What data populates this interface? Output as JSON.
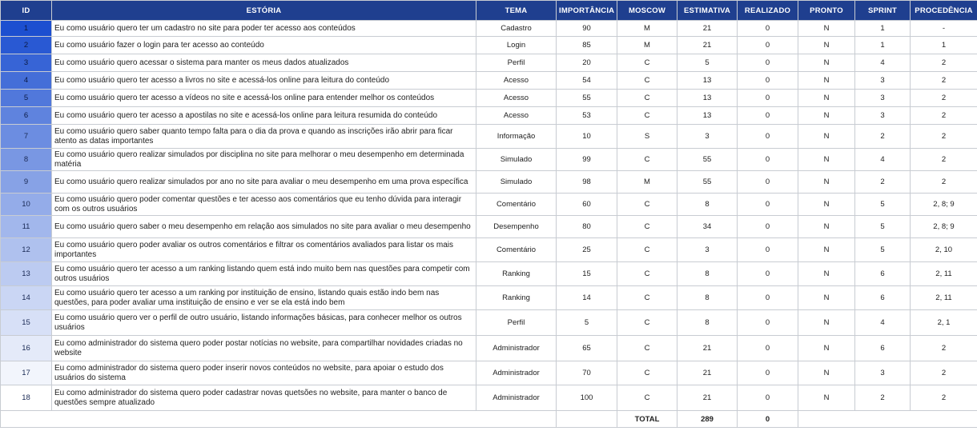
{
  "headers": [
    "ID",
    "ESTÓRIA",
    "TEMA",
    "IMPORTÂNCIA",
    "MOSCOW",
    "ESTIMATIVA",
    "REALIZADO",
    "PRONTO",
    "SPRINT",
    "PROCEDÊNCIA"
  ],
  "rows": [
    {
      "id": "1",
      "story": "Eu como usuário quero ter um cadastro no site para poder ter acesso aos conteúdos",
      "tema": "Cadastro",
      "imp": "90",
      "moscow": "M",
      "est": "21",
      "real": "0",
      "pronto": "N",
      "sprint": "1",
      "proc": "-"
    },
    {
      "id": "2",
      "story": "Eu como usuário fazer o login para ter acesso ao conteúdo",
      "tema": "Login",
      "imp": "85",
      "moscow": "M",
      "est": "21",
      "real": "0",
      "pronto": "N",
      "sprint": "1",
      "proc": "1"
    },
    {
      "id": "3",
      "story": "Eu como usuário quero acessar o sistema para manter os meus dados atualizados",
      "tema": "Perfil",
      "imp": "20",
      "moscow": "C",
      "est": "5",
      "real": "0",
      "pronto": "N",
      "sprint": "4",
      "proc": "2"
    },
    {
      "id": "4",
      "story": "Eu como usuário quero ter acesso a livros no site e acessá-los online para leitura do conteúdo",
      "tema": "Acesso",
      "imp": "54",
      "moscow": "C",
      "est": "13",
      "real": "0",
      "pronto": "N",
      "sprint": "3",
      "proc": "2"
    },
    {
      "id": "5",
      "story": "Eu como usuário quero ter acesso a vídeos no site e acessá-los online para entender melhor os conteúdos",
      "tema": "Acesso",
      "imp": "55",
      "moscow": "C",
      "est": "13",
      "real": "0",
      "pronto": "N",
      "sprint": "3",
      "proc": "2"
    },
    {
      "id": "6",
      "story": "Eu como usuário quero ter acesso a apostilas no site e acessá-los online para leitura resumida do conteúdo",
      "tema": "Acesso",
      "imp": "53",
      "moscow": "C",
      "est": "13",
      "real": "0",
      "pronto": "N",
      "sprint": "3",
      "proc": "2"
    },
    {
      "id": "7",
      "story": "Eu como usuário quero saber quanto tempo falta para o dia da prova e quando as inscrições irão abrir para ficar atento as datas importantes",
      "tema": "Informação",
      "imp": "10",
      "moscow": "S",
      "est": "3",
      "real": "0",
      "pronto": "N",
      "sprint": "2",
      "proc": "2"
    },
    {
      "id": "8",
      "story": "Eu como usuário quero realizar simulados por disciplina no site para melhorar o meu desempenho em determinada matéria",
      "tema": "Simulado",
      "imp": "99",
      "moscow": "C",
      "est": "55",
      "real": "0",
      "pronto": "N",
      "sprint": "4",
      "proc": "2"
    },
    {
      "id": "9",
      "story": "Eu como usuário quero realizar simulados por ano no site para avaliar o meu desempenho em uma prova específica",
      "tema": "Simulado",
      "imp": "98",
      "moscow": "M",
      "est": "55",
      "real": "0",
      "pronto": "N",
      "sprint": "2",
      "proc": "2"
    },
    {
      "id": "10",
      "story": "Eu como usuário quero poder comentar questões e ter acesso aos comentários que eu tenho dúvida para interagir com os outros usuários",
      "tema": "Comentário",
      "imp": "60",
      "moscow": "C",
      "est": "8",
      "real": "0",
      "pronto": "N",
      "sprint": "5",
      "proc": "2, 8; 9"
    },
    {
      "id": "11",
      "story": "Eu como usuário quero saber o meu desempenho em relação aos simulados no site para avaliar o meu desempenho",
      "tema": "Desempenho",
      "imp": "80",
      "moscow": "C",
      "est": "34",
      "real": "0",
      "pronto": "N",
      "sprint": "5",
      "proc": "2, 8; 9"
    },
    {
      "id": "12",
      "story": "Eu como usuário quero poder avaliar os outros comentários e filtrar os comentários avaliados para listar os mais importantes",
      "tema": "Comentário",
      "imp": "25",
      "moscow": "C",
      "est": "3",
      "real": "0",
      "pronto": "N",
      "sprint": "5",
      "proc": "2, 10"
    },
    {
      "id": "13",
      "story": "Eu como usuário quero ter acesso a um ranking listando quem está indo muito bem nas questões para competir com outros usuários",
      "tema": "Ranking",
      "imp": "15",
      "moscow": "C",
      "est": "8",
      "real": "0",
      "pronto": "N",
      "sprint": "6",
      "proc": "2, 11"
    },
    {
      "id": "14",
      "story": "Eu como usuário quero ter acesso a um ranking por instituição de ensino, listando quais estão indo bem nas questões, para poder avaliar uma instituição de ensino e ver se ela está indo bem",
      "tema": "Ranking",
      "imp": "14",
      "moscow": "C",
      "est": "8",
      "real": "0",
      "pronto": "N",
      "sprint": "6",
      "proc": "2, 11"
    },
    {
      "id": "15",
      "story": "Eu como usuário quero ver o perfil de outro usuário, listando informações básicas, para conhecer melhor os outros usuários",
      "tema": "Perfil",
      "imp": "5",
      "moscow": "C",
      "est": "8",
      "real": "0",
      "pronto": "N",
      "sprint": "4",
      "proc": "2, 1"
    },
    {
      "id": "16",
      "story": "Eu como administrador do sistema quero poder postar notícias no website, para compartilhar novidades criadas no website",
      "tema": "Administrador",
      "imp": "65",
      "moscow": "C",
      "est": "21",
      "real": "0",
      "pronto": "N",
      "sprint": "6",
      "proc": "2"
    },
    {
      "id": "17",
      "story": "Eu como administrador do sistema quero poder inserir novos conteúdos no website, para apoiar o estudo dos usuários do sistema",
      "tema": "Administrador",
      "imp": "70",
      "moscow": "C",
      "est": "21",
      "real": "0",
      "pronto": "N",
      "sprint": "3",
      "proc": "2"
    },
    {
      "id": "18",
      "story": "Eu como administrador do sistema quero poder cadastrar novas quetsões no website, para manter o banco de questões sempre atualizado",
      "tema": "Administrador",
      "imp": "100",
      "moscow": "C",
      "est": "21",
      "real": "0",
      "pronto": "N",
      "sprint": "2",
      "proc": "2"
    }
  ],
  "total": {
    "label": "TOTAL",
    "estimativa": "289",
    "realizado": "0"
  },
  "colors": {
    "header_bg": "#1f3f8f",
    "id_start": "#1c4fd0",
    "id_end": "#ffffff",
    "grid": "#c8ccd2"
  }
}
